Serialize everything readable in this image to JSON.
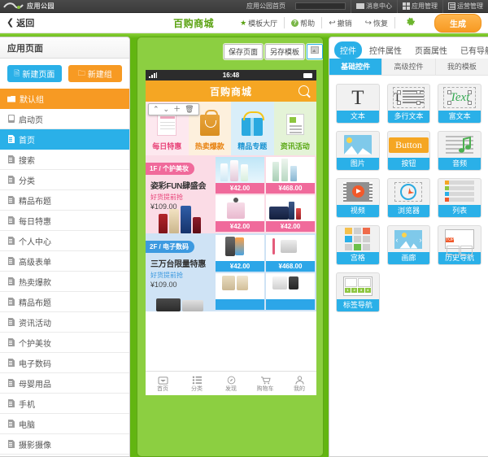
{
  "topbar": {
    "logo_text": "应用公园",
    "links": [
      {
        "label": "应用公园首页",
        "icon": ""
      },
      {
        "label": "消息中心",
        "icon": "mail-icon"
      },
      {
        "label": "应用管理",
        "icon": "grid-icon"
      },
      {
        "label": "运营管理",
        "icon": "lines-icon"
      }
    ],
    "search_value": ""
  },
  "toolbar": {
    "back_label": "返回",
    "project_title": "百购商城",
    "template_hall": "模板大厅",
    "help": "帮助",
    "undo": "撤销",
    "redo": "恢复",
    "generate": "生成"
  },
  "sidebar": {
    "header": "应用页面",
    "new_page_btn": "新建页面",
    "new_group_btn": "新建组",
    "group_label": "默认组",
    "items": [
      {
        "label": "启动页",
        "icon": "start-page-icon",
        "active": false
      },
      {
        "label": "首页",
        "icon": "page-icon",
        "active": true
      },
      {
        "label": "搜索",
        "icon": "page-icon",
        "active": false
      },
      {
        "label": "分类",
        "icon": "page-icon",
        "active": false
      },
      {
        "label": "精品布题",
        "icon": "page-icon",
        "active": false
      },
      {
        "label": "每日特惠",
        "icon": "page-icon",
        "active": false
      },
      {
        "label": "个人中心",
        "icon": "page-icon",
        "active": false
      },
      {
        "label": "高级表单",
        "icon": "page-icon",
        "active": false
      },
      {
        "label": "热卖爆款",
        "icon": "page-icon",
        "active": false
      },
      {
        "label": "精品布题",
        "icon": "page-icon",
        "active": false
      },
      {
        "label": "资讯活动",
        "icon": "page-icon",
        "active": false
      },
      {
        "label": "个护美妆",
        "icon": "page-icon",
        "active": false
      },
      {
        "label": "电子数码",
        "icon": "page-icon",
        "active": false
      },
      {
        "label": "母婴用品",
        "icon": "page-icon",
        "active": false
      },
      {
        "label": "手机",
        "icon": "page-icon",
        "active": false
      },
      {
        "label": "电脑",
        "icon": "page-icon",
        "active": false
      },
      {
        "label": "摄影摄像",
        "icon": "page-icon",
        "active": false
      }
    ]
  },
  "preview": {
    "save_page_btn": "保存页面",
    "save_template_btn": "另存模板",
    "preview_icon_btn": "preview-icon",
    "phone": {
      "status_time": "16:48",
      "app_title": "百购商城",
      "search_icon": "search-icon",
      "selection_toolbar": {
        "move_up": "⌃",
        "move_down": "⌄",
        "add": "＋",
        "delete": "🗑"
      },
      "categories": [
        {
          "label": "每日特惠",
          "art": "ticket"
        },
        {
          "label": "热卖爆款",
          "art": "bag"
        },
        {
          "label": "精品专题",
          "art": "gift"
        },
        {
          "label": "资讯活动",
          "art": "news"
        }
      ],
      "floors": [
        {
          "badge": "1F / 个护美妆",
          "title": "姿彩FUN肆盛会",
          "subtitle": "好货提前抢",
          "price": "¥109.00",
          "products": [
            {
              "price": "¥42.00"
            },
            {
              "price": "¥468.00"
            },
            {
              "price": "¥42.00"
            },
            {
              "price": "¥42.00"
            }
          ]
        },
        {
          "badge": "2F / 电子数码",
          "title": "三万台限量特惠",
          "subtitle": "好货提前抢",
          "price": "¥109.00",
          "products": [
            {
              "price": "¥42.00"
            },
            {
              "price": "¥468.00"
            },
            {
              "price": ""
            },
            {
              "price": ""
            }
          ]
        }
      ],
      "tabbar": [
        {
          "label": "首页",
          "icon": "home-icon"
        },
        {
          "label": "分类",
          "icon": "category-icon"
        },
        {
          "label": "发现",
          "icon": "compass-icon"
        },
        {
          "label": "购物车",
          "icon": "cart-icon"
        },
        {
          "label": "我的",
          "icon": "user-icon"
        }
      ]
    }
  },
  "rightpanel": {
    "tabs": [
      {
        "label": "控件",
        "active": true
      },
      {
        "label": "控件属性",
        "active": false
      },
      {
        "label": "页面属性",
        "active": false
      },
      {
        "label": "已有导航",
        "active": false
      }
    ],
    "subtabs": [
      {
        "label": "基础控件",
        "active": true
      },
      {
        "label": "高级控件",
        "active": false
      },
      {
        "label": "我的模板",
        "active": false
      }
    ],
    "widgets": [
      {
        "label": "文本",
        "art": "text"
      },
      {
        "label": "多行文本",
        "art": "multiline"
      },
      {
        "label": "富文本",
        "art": "richtext",
        "sample": "Text"
      },
      {
        "label": "图片",
        "art": "image"
      },
      {
        "label": "按钮",
        "art": "button",
        "sample": "Button"
      },
      {
        "label": "音频",
        "art": "audio"
      },
      {
        "label": "视频",
        "art": "video"
      },
      {
        "label": "浏览器",
        "art": "browser"
      },
      {
        "label": "列表",
        "art": "list"
      },
      {
        "label": "宫格",
        "art": "grid"
      },
      {
        "label": "画廊",
        "art": "gallery"
      },
      {
        "label": "历史导航",
        "art": "history",
        "sample": "TOP"
      },
      {
        "label": "标签导航",
        "art": "tabnav"
      }
    ]
  },
  "colors": {
    "brand_green": "#62b511",
    "accent_blue": "#2ab0e8",
    "accent_orange": "#f79a23",
    "header_orange": "#f5a623",
    "pink": "#f06a9b"
  }
}
